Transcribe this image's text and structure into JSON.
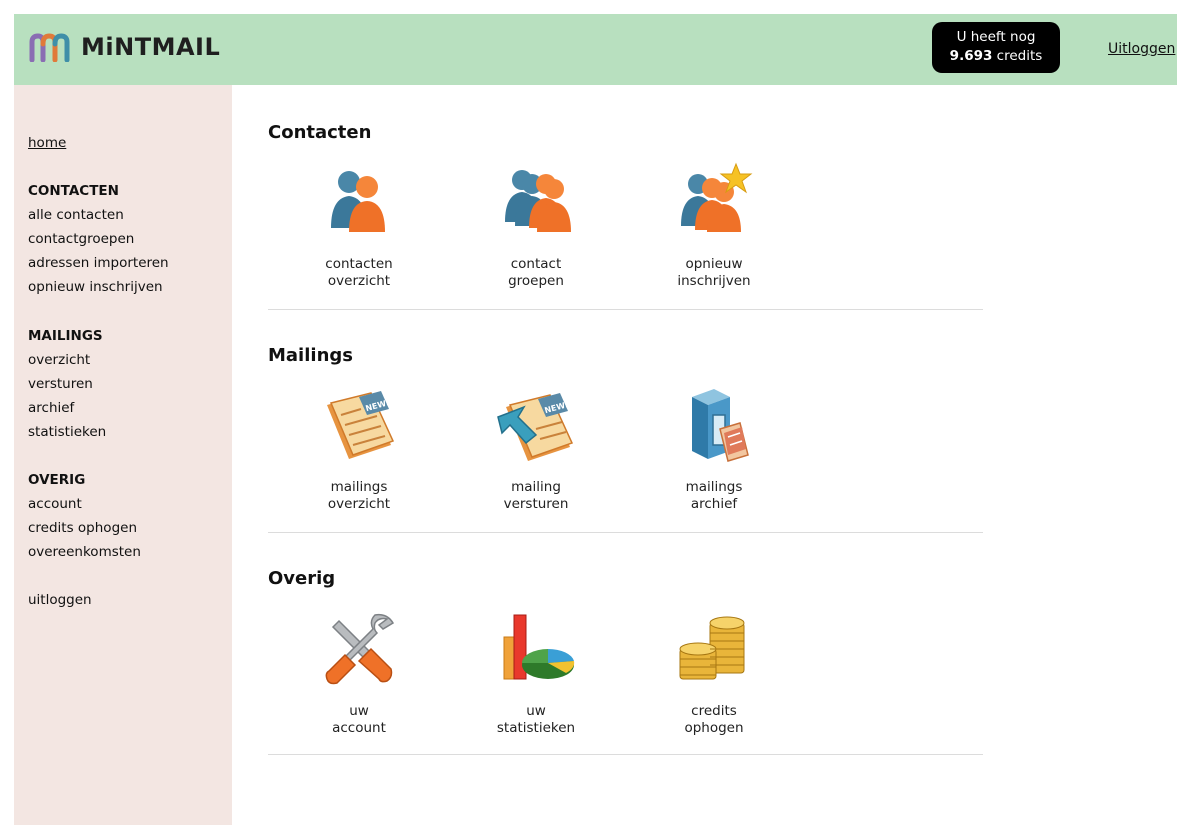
{
  "header": {
    "brand": "MiNTMAIL",
    "credits_line1": "U heeft nog",
    "credits_amount": "9.693",
    "credits_unit": "credits",
    "logout": "Uitloggen"
  },
  "sidebar": {
    "home": "home",
    "contacten_heading": "CONTACTEN",
    "contacten_items": [
      "alle contacten",
      "contactgroepen",
      "adressen importeren",
      "opnieuw inschrijven"
    ],
    "mailings_heading": "MAILINGS",
    "mailings_items": [
      "overzicht",
      "versturen",
      "archief",
      "statistieken"
    ],
    "overig_heading": "OVERIG",
    "overig_items": [
      "account",
      "credits ophogen",
      "overeenkomsten"
    ],
    "logout": "uitloggen"
  },
  "sections": [
    {
      "title": "Contacten",
      "tiles": [
        {
          "icon": "contacts-icon",
          "line1": "contacten",
          "line2": "overzicht"
        },
        {
          "icon": "contact-groups-icon",
          "line1": "contact",
          "line2": "groepen"
        },
        {
          "icon": "resubscribe-icon",
          "line1": "opnieuw",
          "line2": "inschrijven"
        }
      ]
    },
    {
      "title": "Mailings",
      "tiles": [
        {
          "icon": "newspaper-icon",
          "line1": "mailings",
          "line2": "overzicht"
        },
        {
          "icon": "send-newspaper-icon",
          "line1": "mailing",
          "line2": "versturen"
        },
        {
          "icon": "archive-cabinet-icon",
          "line1": "mailings",
          "line2": "archief"
        }
      ]
    },
    {
      "title": "Overig",
      "tiles": [
        {
          "icon": "tools-icon",
          "line1": "uw",
          "line2": "account"
        },
        {
          "icon": "statistics-chart-icon",
          "line1": "uw",
          "line2": "statistieken"
        },
        {
          "icon": "coins-icon",
          "line1": "credits",
          "line2": "ophogen"
        }
      ]
    }
  ]
}
